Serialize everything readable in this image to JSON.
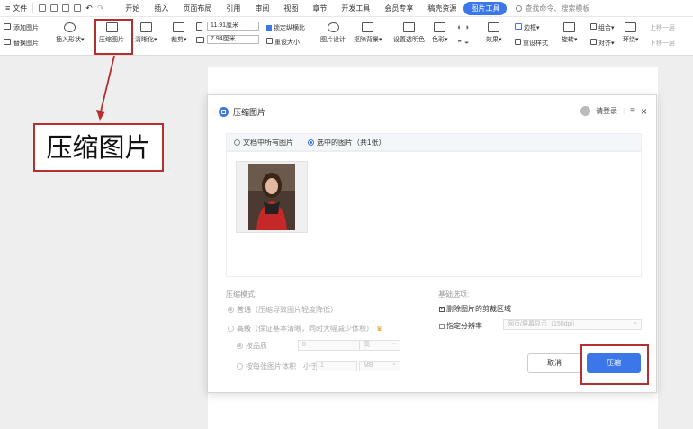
{
  "menubar": {
    "file_label": "文件",
    "tabs": [
      "开始",
      "插入",
      "页面布局",
      "引用",
      "审阅",
      "视图",
      "章节",
      "开发工具",
      "会员专享",
      "稿壳资源",
      "图片工具"
    ],
    "active_tab": "图片工具",
    "search_placeholder": "查找命令、搜索模板"
  },
  "ribbon": {
    "add_picture": "添加图片",
    "replace_picture": "替换图片",
    "insert_shape": "插入形状",
    "compress_picture": "压缩图片",
    "sharpen": "清晰化",
    "crop": "裁剪",
    "width_value": "11.91厘米",
    "height_value": "7.94厘米",
    "lock_ratio": "锁定纵横比",
    "reset_size": "重设大小",
    "picture_design": "图片设计",
    "remove_background": "抠除背景",
    "set_transparent": "设置透明色",
    "color": "色彩",
    "effects": "效果",
    "border": "边框",
    "reset_style": "重设样式",
    "rotate": "旋转",
    "combine": "组合",
    "align": "对齐",
    "wrap": "环绕",
    "bring_forward": "上移一层",
    "send_backward": "下移一层"
  },
  "annotation": {
    "callout_text": "压缩图片",
    "accent_color": "#b52f2f"
  },
  "dialog": {
    "title": "压缩图片",
    "login": "请登录",
    "scope_all": "文档中所有图片",
    "scope_selected": "选中的图片（共1张）",
    "mode_label": "压缩模式:",
    "mode_normal": "普通",
    "mode_normal_desc": "（压缩导致图片轻度降低）",
    "mode_advanced": "高级",
    "mode_advanced_desc": "（保证基本清晰，同时大幅减少体积）",
    "by_quality": "按品质",
    "quality_value": "0",
    "quality_unit": "高",
    "by_size": "按每张图片体积",
    "size_less_than": "小于",
    "size_value": "1",
    "size_unit": "MB",
    "basic_options_label": "基础选项:",
    "delete_cropped": "删除图片的剪裁区域",
    "specify_resolution": "指定分辨率",
    "resolution_value": "网页/屏幕显示（150dpi）",
    "cancel": "取消",
    "compress": "压缩",
    "accent_color": "#3b77e8"
  }
}
